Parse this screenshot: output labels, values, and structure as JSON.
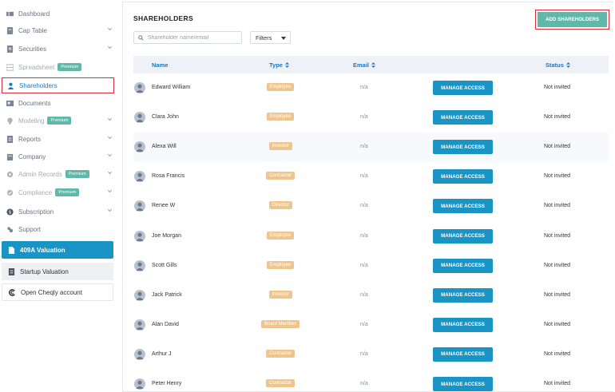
{
  "sidebar": {
    "items": [
      {
        "label": "Dashboard",
        "icon": "dashboard-icon",
        "chevron": false,
        "badge": ""
      },
      {
        "label": "Cap Table",
        "icon": "cap-table-icon",
        "chevron": true,
        "badge": ""
      },
      {
        "label": "Securities",
        "icon": "securities-icon",
        "chevron": true,
        "badge": ""
      },
      {
        "label": "Spreadsheet",
        "icon": "spreadsheet-icon",
        "chevron": false,
        "badge": "Premium"
      },
      {
        "label": "Shareholders",
        "icon": "shareholders-icon",
        "chevron": false,
        "badge": ""
      },
      {
        "label": "Documents",
        "icon": "documents-icon",
        "chevron": false,
        "badge": ""
      },
      {
        "label": "Modeling",
        "icon": "modeling-icon",
        "chevron": true,
        "badge": "Premium"
      },
      {
        "label": "Reports",
        "icon": "reports-icon",
        "chevron": true,
        "badge": ""
      },
      {
        "label": "Company",
        "icon": "company-icon",
        "chevron": true,
        "badge": ""
      },
      {
        "label": "Admin Records",
        "icon": "admin-records-icon",
        "chevron": true,
        "badge": "Premium"
      },
      {
        "label": "Compliance",
        "icon": "compliance-icon",
        "chevron": true,
        "badge": "Premium"
      },
      {
        "label": "Subscription",
        "icon": "subscription-icon",
        "chevron": true,
        "badge": ""
      },
      {
        "label": "Support",
        "icon": "support-icon",
        "chevron": false,
        "badge": ""
      }
    ],
    "active_item": "Shareholders",
    "valuation_label": "409A Valuation",
    "startup_label": "Startup Valuation",
    "cheqly_label": "Open Cheqly account"
  },
  "main": {
    "title": "SHAREHOLDERS",
    "add_button": "ADD SHAREHOLDERS",
    "search_placeholder": "Shareholder name/email",
    "filters_label": "Filters",
    "columns": {
      "name": "Name",
      "type": "Type",
      "email": "Email",
      "status": "Status"
    },
    "rows": [
      {
        "name": "Edward William",
        "type": "Employee",
        "email": "n/a",
        "action": "MANAGE ACCESS",
        "status": "Not invited"
      },
      {
        "name": "Clara John",
        "type": "Employee",
        "email": "n/a",
        "action": "MANAGE ACCESS",
        "status": "Not invited"
      },
      {
        "name": "Alexa Will",
        "type": "Investor",
        "email": "n/a",
        "action": "MANAGE ACCESS",
        "status": "Not invited"
      },
      {
        "name": "Rosa Francis",
        "type": "Contractor",
        "email": "n/a",
        "action": "MANAGE ACCESS",
        "status": "Not invited"
      },
      {
        "name": "Renee W",
        "type": "Director",
        "email": "n/a",
        "action": "MANAGE ACCESS",
        "status": "Not invited"
      },
      {
        "name": "Joe Morgan",
        "type": "Employee",
        "email": "n/a",
        "action": "MANAGE ACCESS",
        "status": "Not invited"
      },
      {
        "name": "Scott Gills",
        "type": "Employee",
        "email": "n/a",
        "action": "MANAGE ACCESS",
        "status": "Not invited"
      },
      {
        "name": "Jack Patrick",
        "type": "Investor",
        "email": "n/a",
        "action": "MANAGE ACCESS",
        "status": "Not invited"
      },
      {
        "name": "Alan David",
        "type": "Board Member",
        "email": "n/a",
        "action": "MANAGE ACCESS",
        "status": "Not invited"
      },
      {
        "name": "Arthur J",
        "type": "Contractor",
        "email": "n/a",
        "action": "MANAGE ACCESS",
        "status": "Not invited"
      },
      {
        "name": "Peter Henry",
        "type": "Contractor",
        "email": "n/a",
        "action": "MANAGE ACCESS",
        "status": "Not invited"
      }
    ]
  },
  "colors": {
    "accent": "#1a94c4",
    "link": "#1a78c2",
    "premium_badge": "#5fb8a8",
    "type_badge": "#f0c58c",
    "highlight_border": "#d62e3d"
  }
}
